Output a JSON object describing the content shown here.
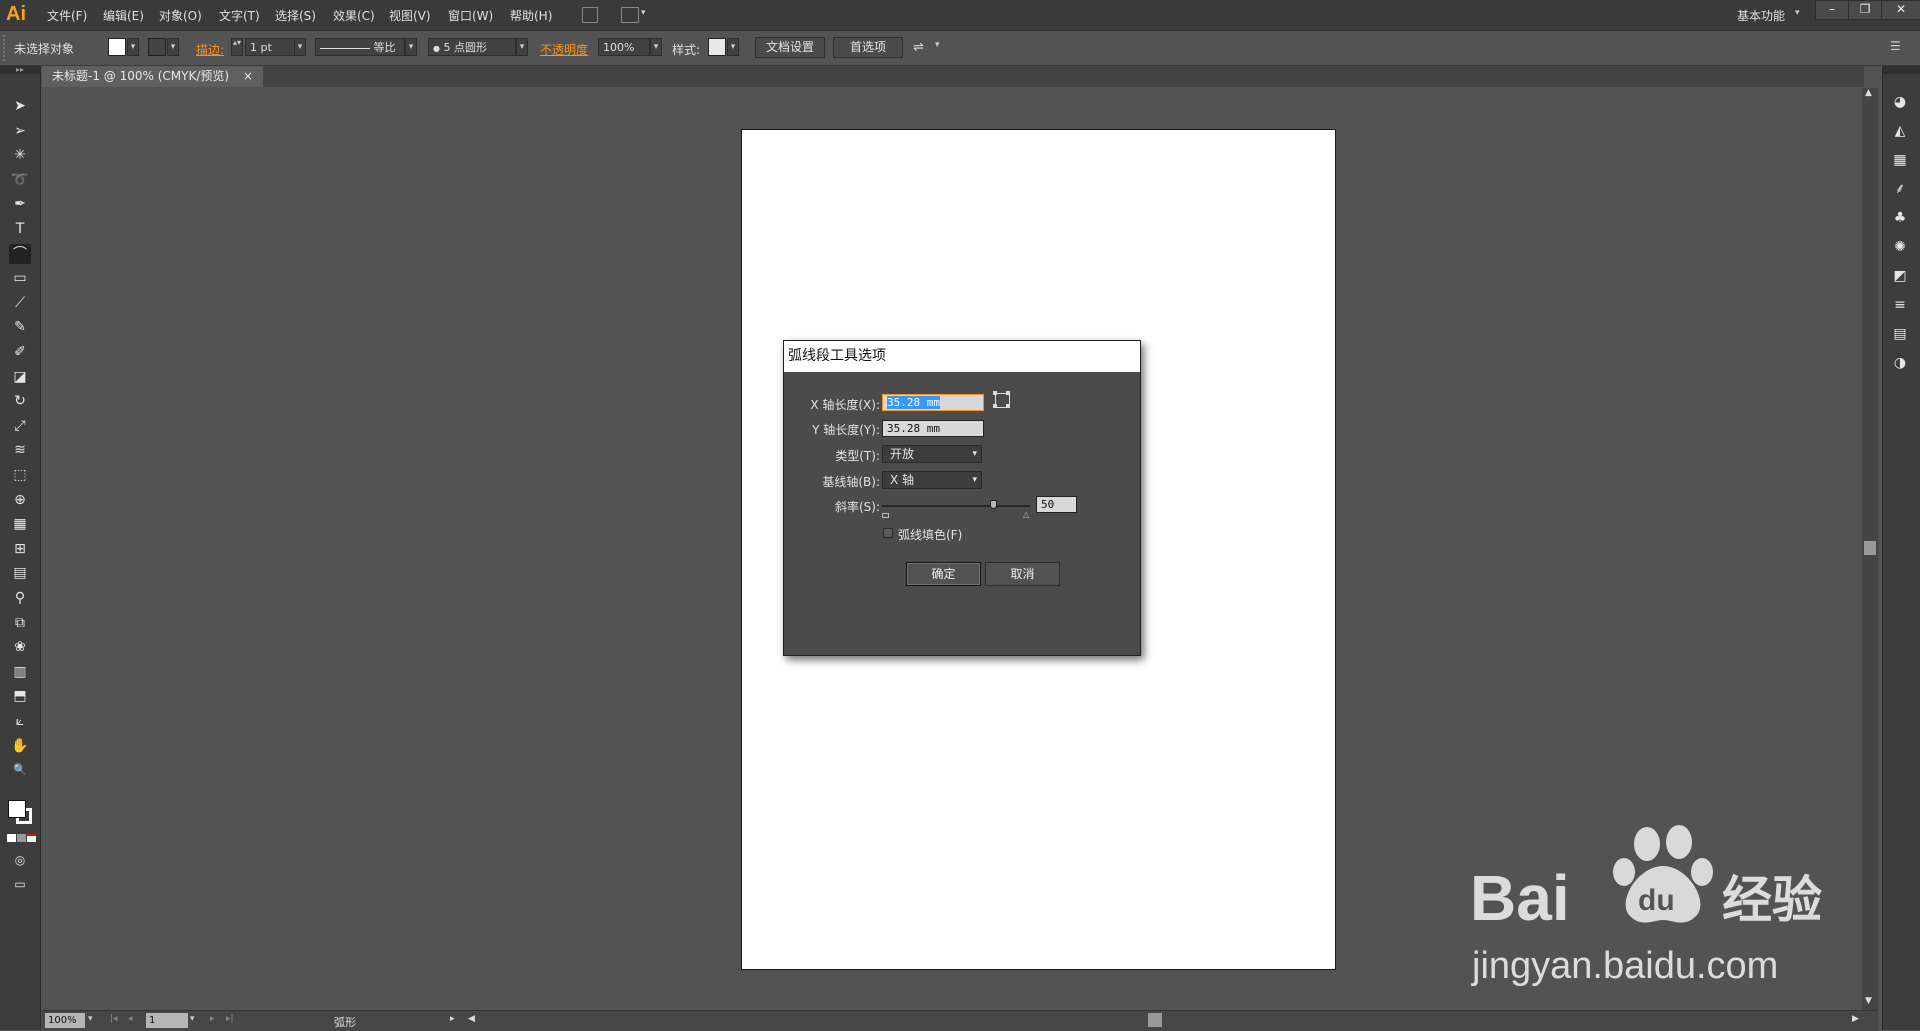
{
  "app": {
    "logo": "Ai"
  },
  "menu": [
    "文件(F)",
    "编辑(E)",
    "对象(O)",
    "文字(T)",
    "选择(S)",
    "效果(C)",
    "视图(V)",
    "窗口(W)",
    "帮助(H)"
  ],
  "workspace": {
    "label": "基本功能"
  },
  "window_buttons": {
    "minimize": "–",
    "restore": "❐",
    "close": "✕"
  },
  "control_bar": {
    "selection": "未选择对象",
    "stroke_label": "描边:",
    "stroke_weight": "1 pt",
    "stroke_profile": "等比",
    "brush": "5 点圆形",
    "opacity_label": "不透明度",
    "opacity_value": "100%",
    "style_label": "样式:",
    "doc_setup": "文档设置",
    "preferences": "首选项"
  },
  "document_tab": {
    "title": "未标题-1 @ 100% (CMYK/预览)",
    "close": "×"
  },
  "tools": [
    "selection-icon",
    "direct-selection-icon",
    "magic-wand-icon",
    "lasso-icon",
    "pen-icon",
    "type-icon",
    "arc-icon",
    "rectangle-icon",
    "paintbrush-icon",
    "pencil-icon",
    "blob-brush-icon",
    "eraser-icon",
    "rotate-icon",
    "scale-icon",
    "warp-icon",
    "free-transform-icon",
    "shape-builder-icon",
    "perspective-grid-icon",
    "mesh-icon",
    "gradient-icon",
    "eyedropper-icon",
    "blend-icon",
    "symbol-sprayer-icon",
    "column-graph-icon",
    "artboard-icon",
    "slice-icon",
    "hand-icon",
    "zoom-icon"
  ],
  "active_tool": "arc-icon",
  "right_panels": [
    "color-icon",
    "color-guide-icon",
    "swatches-icon",
    "brushes-icon",
    "symbols-icon",
    "graphic-styles-icon",
    "appearance-icon",
    "stroke-icon",
    "gradient-icon",
    "transparency-icon"
  ],
  "status_bar": {
    "zoom": "100%",
    "page": "1",
    "tool_name": "弧形"
  },
  "dialog": {
    "title": "弧线段工具选项",
    "x_label": "X 轴长度(X):",
    "x_value": "35.28 mm",
    "y_label": "Y 轴长度(Y):",
    "y_value": "35.28 mm",
    "type_label": "类型(T):",
    "type_value": "开放",
    "base_label": "基线轴(B):",
    "base_value": "X 轴",
    "slope_label": "斜率(S):",
    "slope_value": "50",
    "fill_label": "弧线填色(F)",
    "fill_checked": false,
    "ok": "确定",
    "cancel": "取消"
  },
  "watermark": {
    "brand": "Bai",
    "brand_2": "du",
    "brand_cn": "经验",
    "url": "jingyan.baidu.com"
  },
  "colors": {
    "accent": "#f7941d",
    "selection": "#3399ff",
    "artboard": "#ffffff",
    "workspace": "#535353"
  }
}
